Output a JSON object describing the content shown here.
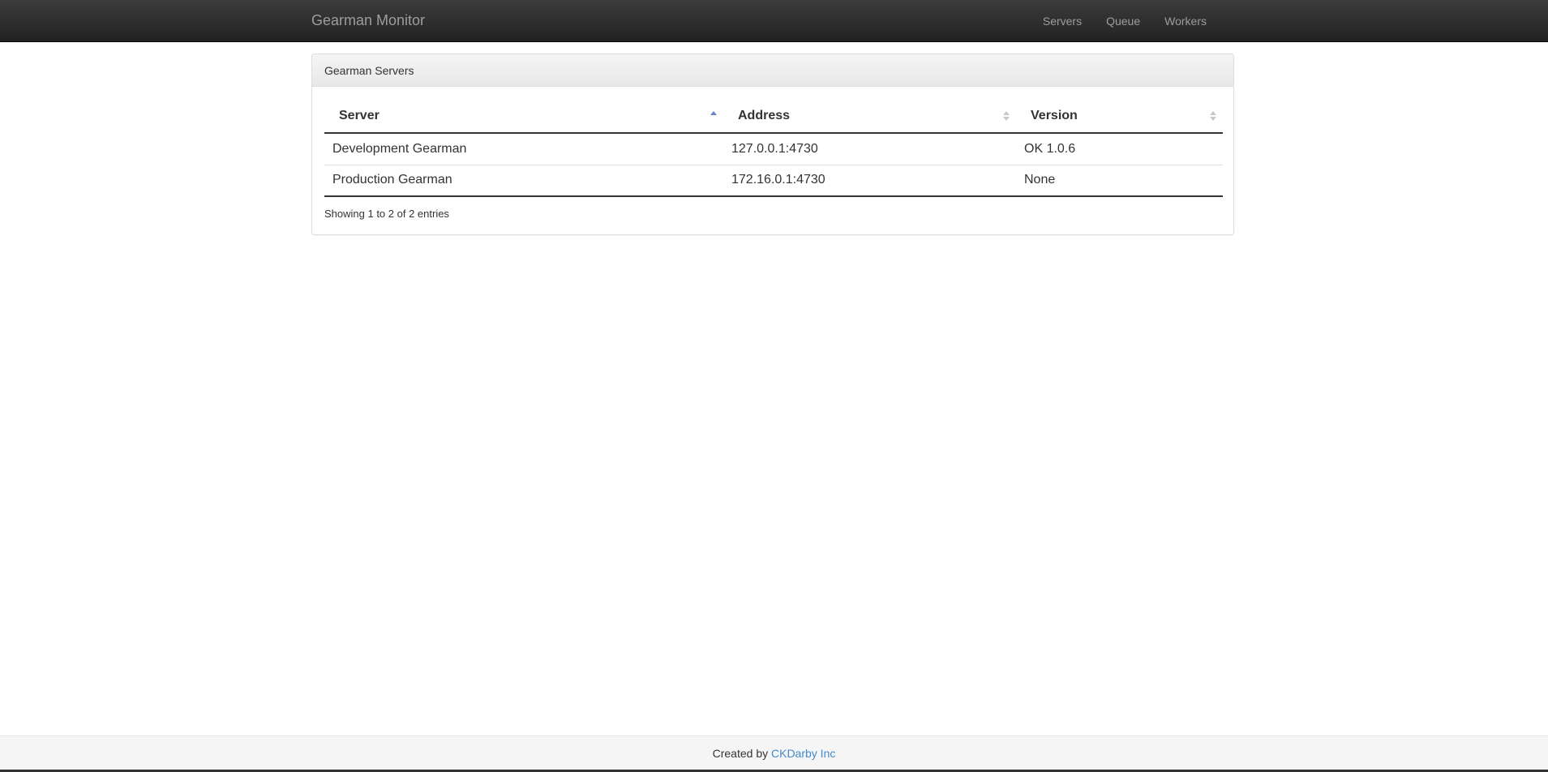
{
  "navbar": {
    "brand": "Gearman Monitor",
    "links": [
      {
        "label": "Servers"
      },
      {
        "label": "Queue"
      },
      {
        "label": "Workers"
      }
    ]
  },
  "panel": {
    "title": "Gearman Servers",
    "table": {
      "columns": [
        {
          "label": "Server",
          "sort": "ascending"
        },
        {
          "label": "Address",
          "sort": "none"
        },
        {
          "label": "Version",
          "sort": "none"
        }
      ],
      "rows": [
        [
          "Development Gearman",
          "127.0.0.1:4730",
          "OK 1.0.6"
        ],
        [
          "Production Gearman",
          "172.16.0.1:4730",
          "None"
        ]
      ]
    },
    "info": "Showing 1 to 2 of 2 entries"
  },
  "footer": {
    "prefix": "Created by",
    "link_label": "CKDarby Inc"
  },
  "colors": {
    "navbar_bg": "#222222",
    "nav_text": "#9d9d9d",
    "link": "#428bca",
    "sort_active": "#6c82c8",
    "sort_inactive": "#c8c8c8"
  },
  "icons": {
    "sort_asc": "sort-asc-icon",
    "sort_both": "sort-both-icon"
  }
}
